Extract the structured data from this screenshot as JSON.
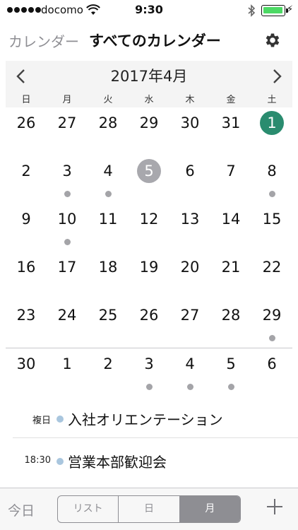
{
  "status_bar": {
    "carrier": "docomo",
    "time": "9:30"
  },
  "nav": {
    "back_label": "カレンダー",
    "title": "すべてのカレンダー",
    "settings_icon": "gear-icon"
  },
  "calendar": {
    "month_title": "2017年4月",
    "weekdays": [
      "日",
      "月",
      "火",
      "水",
      "木",
      "金",
      "土"
    ],
    "weeks": [
      [
        {
          "d": "26"
        },
        {
          "d": "27"
        },
        {
          "d": "28"
        },
        {
          "d": "29"
        },
        {
          "d": "30"
        },
        {
          "d": "31"
        },
        {
          "d": "1",
          "state": "today"
        }
      ],
      [
        {
          "d": "2"
        },
        {
          "d": "3",
          "dot": true
        },
        {
          "d": "4",
          "dot": true
        },
        {
          "d": "5",
          "state": "selected"
        },
        {
          "d": "6"
        },
        {
          "d": "7"
        },
        {
          "d": "8",
          "dot": true
        }
      ],
      [
        {
          "d": "9"
        },
        {
          "d": "10",
          "dot": true
        },
        {
          "d": "11"
        },
        {
          "d": "12"
        },
        {
          "d": "13"
        },
        {
          "d": "14"
        },
        {
          "d": "15"
        }
      ],
      [
        {
          "d": "16"
        },
        {
          "d": "17"
        },
        {
          "d": "18"
        },
        {
          "d": "19"
        },
        {
          "d": "20"
        },
        {
          "d": "21"
        },
        {
          "d": "22"
        }
      ],
      [
        {
          "d": "23"
        },
        {
          "d": "24"
        },
        {
          "d": "25"
        },
        {
          "d": "26"
        },
        {
          "d": "27"
        },
        {
          "d": "28"
        },
        {
          "d": "29",
          "dot": true
        }
      ],
      [
        {
          "d": "30"
        },
        {
          "d": "1"
        },
        {
          "d": "2"
        },
        {
          "d": "3",
          "dot": true
        },
        {
          "d": "4",
          "dot": true
        },
        {
          "d": "5",
          "dot": true
        },
        {
          "d": "6"
        }
      ]
    ],
    "colors": {
      "today": "#2a8c6f",
      "selected": "#a8a8ad",
      "event_dot": "#a4a4a8"
    }
  },
  "events": [
    {
      "time": "複日",
      "title": "入社オリエンテーション",
      "color": "#a9c6de"
    },
    {
      "time": "18:30",
      "title": "営業本部歓迎会",
      "color": "#a9c6de"
    }
  ],
  "toolbar": {
    "today_label": "今日",
    "segments": [
      {
        "label": "リスト",
        "active": false
      },
      {
        "label": "日",
        "active": false
      },
      {
        "label": "月",
        "active": true
      }
    ],
    "add_icon": "plus-icon"
  }
}
